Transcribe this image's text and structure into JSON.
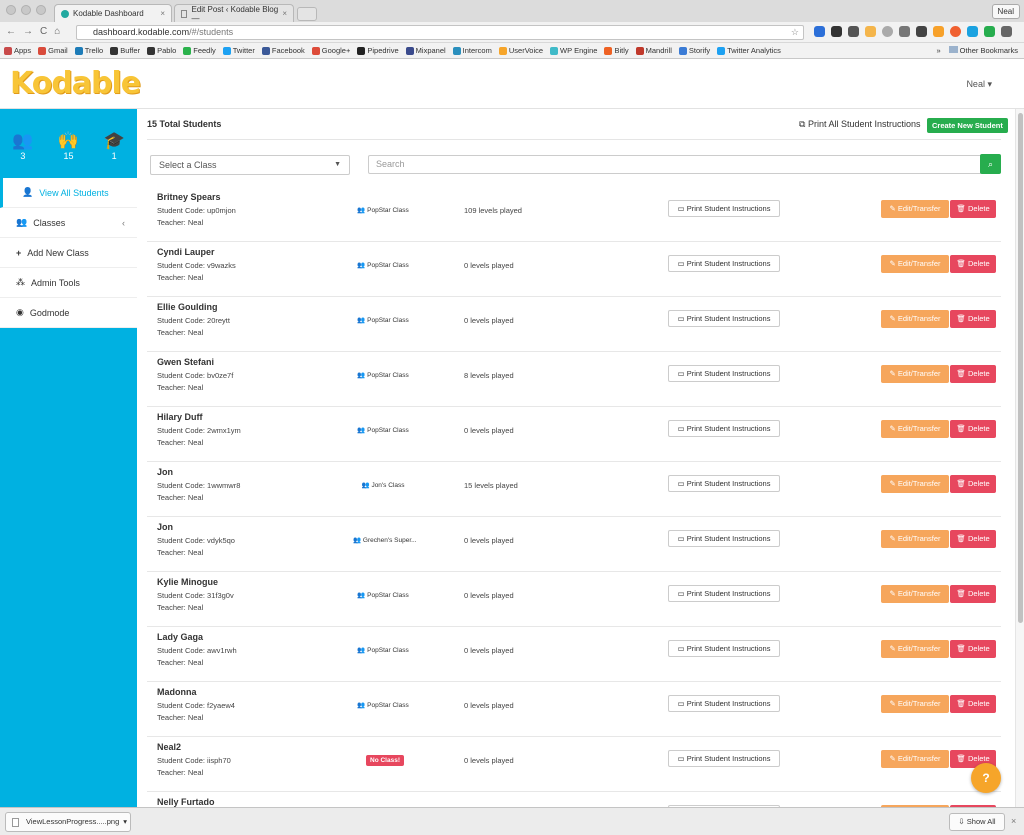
{
  "browser": {
    "tabs": [
      {
        "label": "Kodable Dashboard",
        "active": true
      },
      {
        "label": "Edit Post ‹ Kodable Blog —",
        "active": false
      }
    ],
    "profile": "Neal",
    "url_host": "dashboard.kodable.com",
    "url_path": "/#/students",
    "bookmarks": [
      "Apps",
      "Gmail",
      "Trello",
      "Buffer",
      "Pablo",
      "Feedly",
      "Twitter",
      "Facebook",
      "Google+",
      "Pipedrive",
      "Mixpanel",
      "Intercom",
      "UserVoice",
      "WP Engine",
      "Bitly",
      "Mandrill",
      "Storify",
      "Twitter Analytics"
    ],
    "bookmarks_overflow": "»",
    "other_bookmarks": "Other Bookmarks"
  },
  "header": {
    "logo": "Kodable",
    "user": "Neal"
  },
  "sidebar": {
    "stats": [
      {
        "icon": "users-icon",
        "value": "3"
      },
      {
        "icon": "student-icon",
        "value": "15"
      },
      {
        "icon": "graduation-cap-icon",
        "value": "1"
      }
    ],
    "nav": [
      {
        "label": "View All Students"
      },
      {
        "label": "Classes"
      },
      {
        "label": "Add New Class"
      },
      {
        "label": "Admin Tools"
      },
      {
        "label": "Godmode"
      }
    ]
  },
  "main": {
    "total": "15 Total Students",
    "print_all": "Print All Student Instructions",
    "create": "Create New Student",
    "class_select": "Select a Class",
    "search_placeholder": "Search",
    "print_label": "Print Student Instructions",
    "edit_label": "Edit/Transfer",
    "delete_label": "Delete",
    "students": [
      {
        "name": "Britney Spears",
        "code": "Student Code: up0mjon",
        "teacher": "Teacher: Neal",
        "class": "PopStar Class",
        "levels": "109 levels played"
      },
      {
        "name": "Cyndi Lauper",
        "code": "Student Code: v9wazks",
        "teacher": "Teacher: Neal",
        "class": "PopStar Class",
        "levels": "0 levels played"
      },
      {
        "name": "Ellie Goulding",
        "code": "Student Code: 20reytt",
        "teacher": "Teacher: Neal",
        "class": "PopStar Class",
        "levels": "0 levels played"
      },
      {
        "name": "Gwen Stefani",
        "code": "Student Code: bv0ze7f",
        "teacher": "Teacher: Neal",
        "class": "PopStar Class",
        "levels": "8 levels played"
      },
      {
        "name": "Hilary Duff",
        "code": "Student Code: 2wmx1ym",
        "teacher": "Teacher: Neal",
        "class": "PopStar Class",
        "levels": "0 levels played"
      },
      {
        "name": "Jon",
        "code": "Student Code: 1wwmwr8",
        "teacher": "Teacher: Neal",
        "class": "Jon's Class",
        "levels": "15 levels played"
      },
      {
        "name": "Jon",
        "code": "Student Code: vdyk5qo",
        "teacher": "Teacher: Neal",
        "class": "Grechen's Super...",
        "levels": "0 levels played"
      },
      {
        "name": "Kylie Minogue",
        "code": "Student Code: 31f3g0v",
        "teacher": "Teacher: Neal",
        "class": "PopStar Class",
        "levels": "0 levels played"
      },
      {
        "name": "Lady Gaga",
        "code": "Student Code: awv1rwh",
        "teacher": "Teacher: Neal",
        "class": "PopStar Class",
        "levels": "0 levels played"
      },
      {
        "name": "Madonna",
        "code": "Student Code: f2yaew4",
        "teacher": "Teacher: Neal",
        "class": "PopStar Class",
        "levels": "0 levels played"
      },
      {
        "name": "Neal2",
        "code": "Student Code: iisph70",
        "teacher": "Teacher: Neal",
        "class": "No Class!",
        "levels": "0 levels played",
        "no_class": true
      },
      {
        "name": "Nelly Furtado",
        "code": "",
        "teacher": "",
        "class": "",
        "levels": ""
      }
    ]
  },
  "downloads": {
    "file": "ViewLessonProgress.....png",
    "show_all": "Show All"
  },
  "colors": {
    "sidebar": "#00b1e1",
    "success": "#27ad4e",
    "warning": "#f6a65c",
    "danger": "#e7475e",
    "logo": "#f8c537"
  }
}
